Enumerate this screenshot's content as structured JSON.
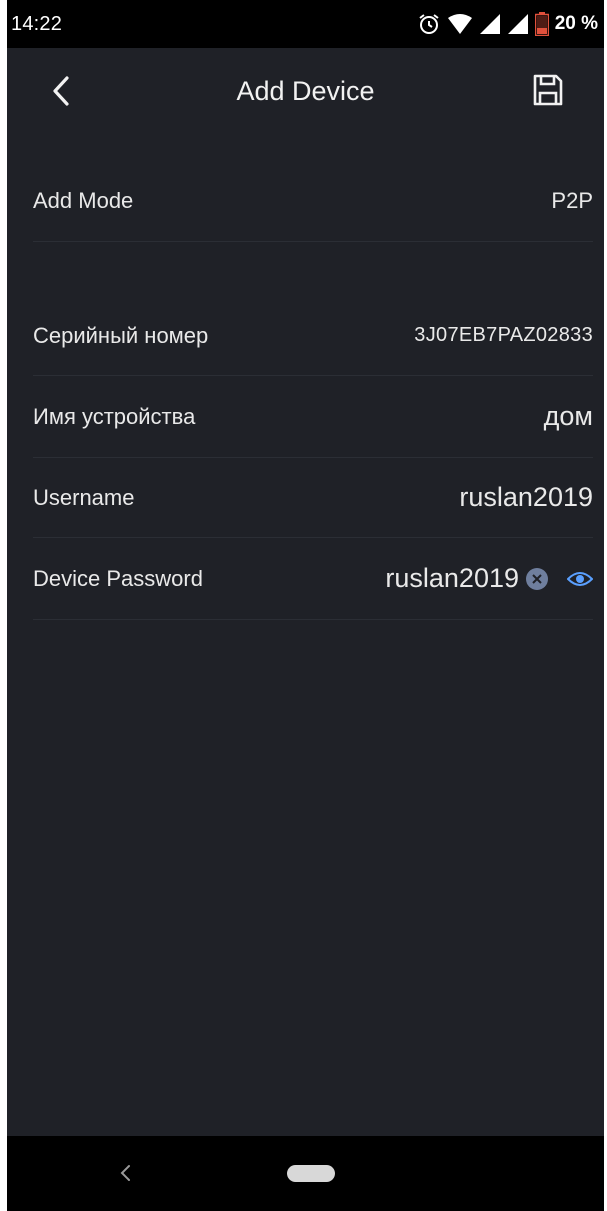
{
  "status_bar": {
    "time": "14:22",
    "battery": "20 %"
  },
  "header": {
    "title": "Add Device"
  },
  "form": {
    "add_mode": {
      "label": "Add Mode",
      "value": "P2P"
    },
    "serial": {
      "label": "Серийный номер",
      "value": "3J07EB7PAZ02833"
    },
    "device_name": {
      "label": "Имя устройства",
      "value": "дом"
    },
    "username": {
      "label": "Username",
      "value": "ruslan2019"
    },
    "password": {
      "label": "Device Password",
      "value": "ruslan2019"
    }
  },
  "icons": {
    "back": "chevron-left-icon",
    "save": "floppy-disk-icon",
    "clear": "clear-icon",
    "eye": "eye-icon",
    "alarm": "alarm-clock-icon",
    "wifi": "wifi-icon",
    "signal": "signal-icon",
    "battery": "battery-icon"
  },
  "colors": {
    "background": "#1f2127",
    "text": "#e9e9e9",
    "accent": "#5aa0ff",
    "battery_low": "#e0513c"
  }
}
